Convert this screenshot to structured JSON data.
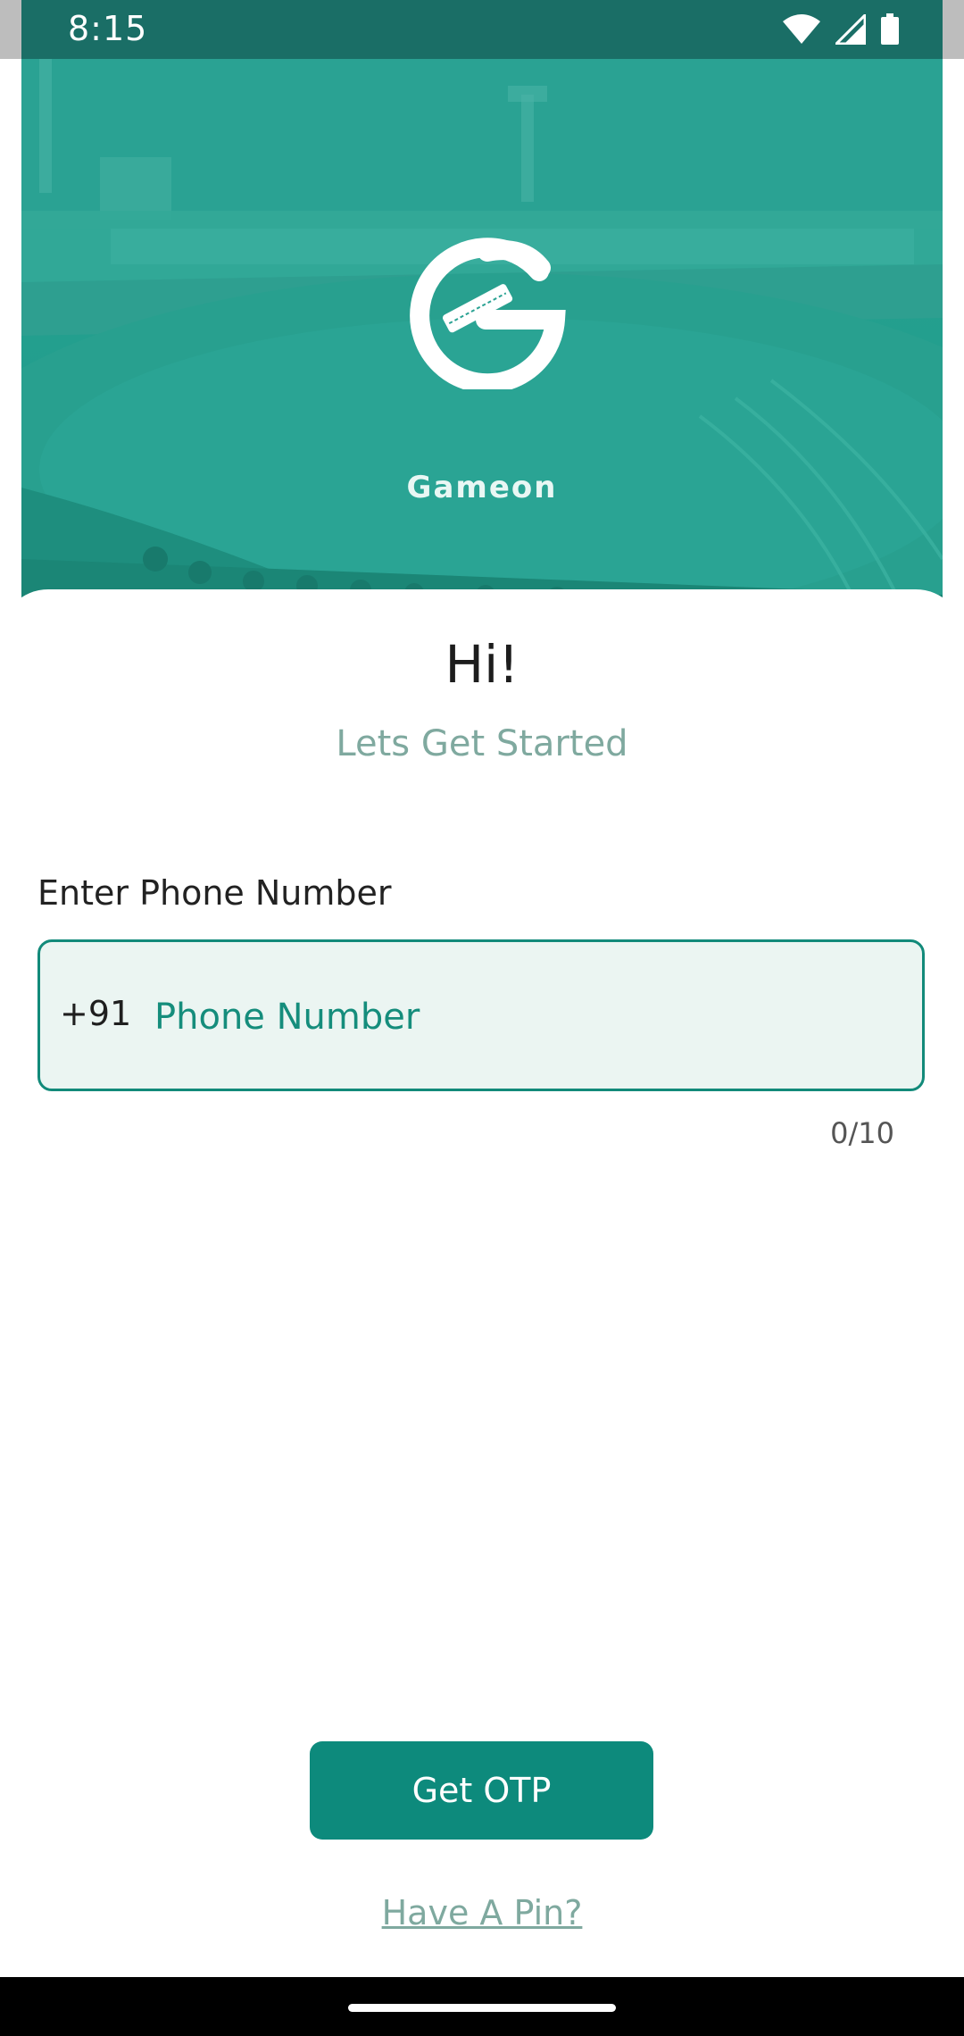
{
  "status_bar": {
    "time": "8:15",
    "icons": [
      "wifi-icon",
      "cell-signal-icon",
      "battery-icon"
    ]
  },
  "hero": {
    "brand_name": "Gameon",
    "logo_icon": "gameon-logo-icon",
    "background": "cricket stadium photo"
  },
  "card": {
    "greeting": "Hi!",
    "subtitle": "Lets Get Started",
    "phone_label": "Enter Phone Number",
    "country_code": "+91",
    "phone_placeholder": "Phone Number",
    "phone_value": "",
    "char_counter": "0/10",
    "otp_button_label": "Get OTP",
    "pin_link_label": "Have A Pin?"
  },
  "colors": {
    "primary": "#0d8a7c",
    "hero_tint": "#24a08f",
    "input_bg": "#ebf5f2",
    "muted_text": "#7fa99f"
  }
}
